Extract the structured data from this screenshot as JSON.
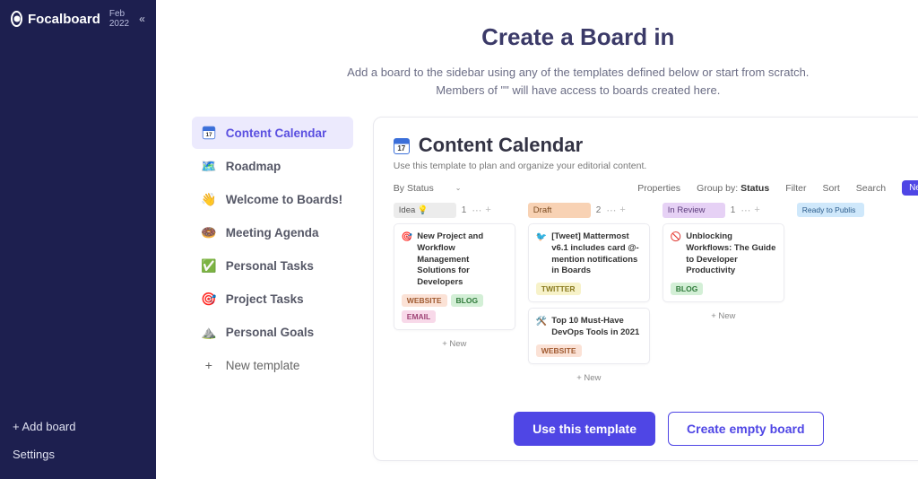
{
  "sidebar": {
    "brand": "Focalboard",
    "brand_sub": "Feb 2022",
    "footer": {
      "add_board": "+ Add board",
      "settings": "Settings"
    }
  },
  "header": {
    "title": "Create a Board in",
    "sub1": "Add a board to the sidebar using any of the templates defined below or start from scratch.",
    "sub2": "Members of \"\" will have access to boards created here."
  },
  "templates": [
    {
      "icon": "📅",
      "label": "Content Calendar",
      "active": true
    },
    {
      "icon": "🗺️",
      "label": "Roadmap"
    },
    {
      "icon": "👋",
      "label": "Welcome to Boards!"
    },
    {
      "icon": "🍩",
      "label": "Meeting Agenda"
    },
    {
      "icon": "✅",
      "label": "Personal Tasks"
    },
    {
      "icon": "🎯",
      "label": "Project Tasks"
    },
    {
      "icon": "⛰️",
      "label": "Personal Goals"
    },
    {
      "icon": "+",
      "label": "New template",
      "isNew": true
    }
  ],
  "preview": {
    "cal_day": "17",
    "title": "Content Calendar",
    "subtitle": "Use this template to plan and organize your editorial content.",
    "toolbar": {
      "view": "By Status",
      "properties": "Properties",
      "group_by_label": "Group by:",
      "group_by_value": "Status",
      "filter": "Filter",
      "sort": "Sort",
      "search": "Search",
      "new": "New"
    },
    "columns": [
      {
        "status": "Idea 💡",
        "pill_class": "p-idea",
        "count": "1",
        "cards": [
          {
            "icon": "🎯",
            "title": "New Project and Workflow Management Solutions for Developers",
            "tags": [
              {
                "t": "WEBSITE",
                "c": "t-website"
              },
              {
                "t": "BLOG",
                "c": "t-blog"
              },
              {
                "t": "EMAIL",
                "c": "t-email"
              }
            ]
          }
        ]
      },
      {
        "status": "Draft",
        "pill_class": "p-draft",
        "count": "2",
        "cards": [
          {
            "icon": "🐦",
            "title": "[Tweet] Mattermost v6.1 includes card @-mention notifications in Boards",
            "tags": [
              {
                "t": "TWITTER",
                "c": "t-twitter"
              }
            ]
          },
          {
            "icon": "🛠️",
            "title": "Top 10 Must-Have DevOps Tools in 2021",
            "tags": [
              {
                "t": "WEBSITE",
                "c": "t-website"
              }
            ]
          }
        ]
      },
      {
        "status": "In Review",
        "pill_class": "p-review",
        "count": "1",
        "cards": [
          {
            "icon": "🚫",
            "title": "Unblocking Workflows: The Guide to Developer Productivity",
            "tags": [
              {
                "t": "BLOG",
                "c": "t-blog"
              }
            ]
          }
        ]
      },
      {
        "status": "Ready to Publis",
        "pill_class": "p-ready",
        "count": "",
        "cards": []
      }
    ],
    "add_new": "+ New"
  },
  "actions": {
    "use": "Use this template",
    "empty": "Create empty board"
  }
}
